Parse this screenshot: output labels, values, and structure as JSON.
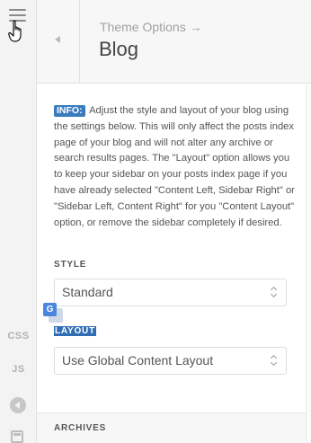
{
  "rail": {
    "css_label": "CSS",
    "js_label": "JS"
  },
  "header": {
    "breadcrumb": "Theme Options →",
    "title": "Blog"
  },
  "info": {
    "badge": "INFO:",
    "text": "Adjust the style and layout of your blog using the settings below. This will only affect the posts index page of your blog and will not alter any archive or search results pages. The \"Layout\" option allows you to keep your sidebar on your posts index page if you have already selected \"Content Left, Sidebar Right\" or \"Sidebar Left, Content Right\" for you \"Content Layout\" option, or remove the sidebar completely if desired."
  },
  "style_field": {
    "label": "STYLE",
    "value": "Standard"
  },
  "layout_field": {
    "label": "LAYOUT",
    "value": "Use Global Content Layout"
  },
  "translate_widget": {
    "glyph": "G"
  },
  "sections": {
    "archives": "ARCHIVES"
  },
  "colors": {
    "info_badge": "#3a7bbf",
    "selection_highlight": "#2f6eb3",
    "translate_icon": "#4a86e0"
  }
}
